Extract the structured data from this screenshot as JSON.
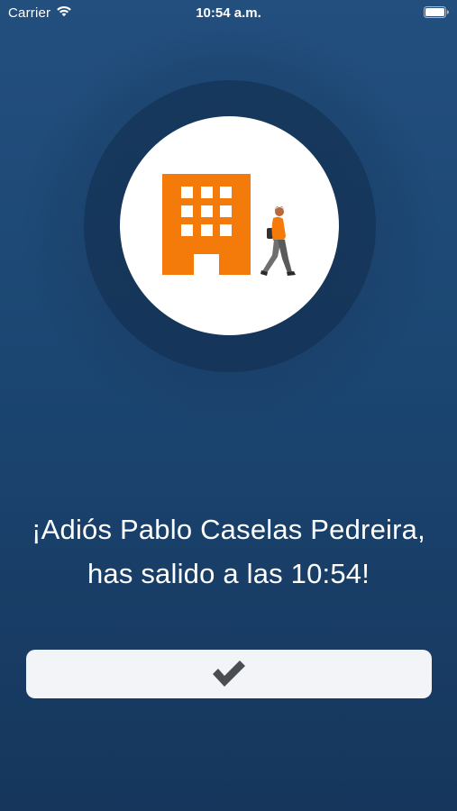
{
  "status_bar": {
    "carrier": "Carrier",
    "time": "10:54 a.m.",
    "wifi_icon": "wifi-icon",
    "battery_icon": "battery-icon"
  },
  "illustration": {
    "building_icon": "building-icon",
    "person_icon": "walking-person-icon",
    "accent_color": "#f47b0a"
  },
  "message": {
    "text": "¡Adiós Pablo Caselas Pedreira, has salido a las 10:54!"
  },
  "confirm_button": {
    "icon": "checkmark-icon"
  },
  "colors": {
    "background_top": "#234f7f",
    "background_bottom": "#16365c",
    "button_background": "#f2f4f7",
    "checkmark": "#4a4d52"
  }
}
